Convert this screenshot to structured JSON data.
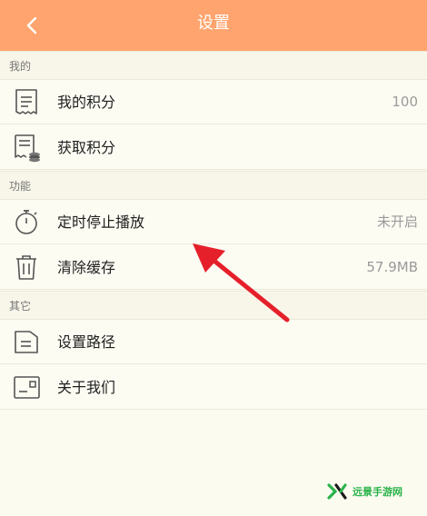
{
  "header": {
    "title": "设置"
  },
  "sections": {
    "mine": "我的",
    "features": "功能",
    "other": "其它"
  },
  "rows": {
    "my_points": {
      "label": "我的积分",
      "value": "100"
    },
    "get_points": {
      "label": "获取积分"
    },
    "sleep_timer": {
      "label": "定时停止播放",
      "value": "未开启"
    },
    "clear_cache": {
      "label": "清除缓存",
      "value": "57.9MB"
    },
    "set_path": {
      "label": "设置路径"
    },
    "about_us": {
      "label": "关于我们"
    }
  },
  "watermark": {
    "text": "远景手游网"
  },
  "colors": {
    "header": "#ffa46e",
    "background": "#fcfbf0",
    "annotation_arrow": "#e5202a"
  },
  "icons": [
    "back-icon",
    "receipt-icon",
    "coins-receipt-icon",
    "stopwatch-icon",
    "trash-icon",
    "folder-icon",
    "info-card-icon"
  ]
}
